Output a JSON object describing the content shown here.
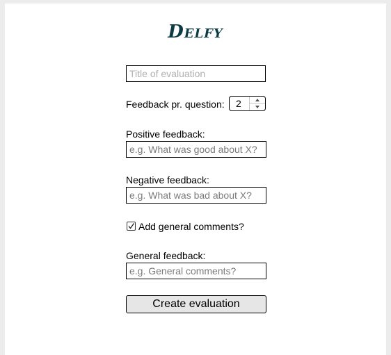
{
  "app": {
    "logo_text": "Delfy"
  },
  "form": {
    "title_input": {
      "value": "",
      "placeholder": "Title of evaluation"
    },
    "feedback_count": {
      "label": "Feedback pr. question:",
      "value": "2"
    },
    "positive": {
      "label": "Positive feedback:",
      "value": "",
      "placeholder": "e.g. What was good about X?"
    },
    "negative": {
      "label": "Negative feedback:",
      "value": "",
      "placeholder": "e.g. What was bad about X?"
    },
    "general_comments_toggle": {
      "label": "Add general comments?",
      "checked": true
    },
    "general": {
      "label": "General feedback:",
      "value": "",
      "placeholder": "e.g. General comments?"
    },
    "submit_label": "Create evaluation"
  },
  "icons": {
    "spin_up": "chevron-up-icon",
    "spin_down": "chevron-down-icon",
    "checkmark": "checkmark-icon"
  },
  "colors": {
    "logo": "#0d3b45",
    "page_background": "#ececec",
    "card_background": "#ffffff",
    "button_background": "#e6e6e6"
  }
}
